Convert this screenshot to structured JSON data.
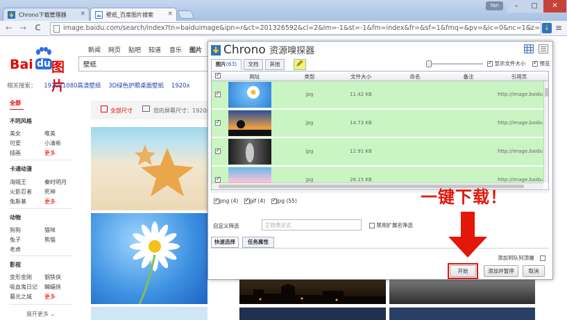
{
  "browser": {
    "tabs": [
      {
        "title": "Chrono下载管理器",
        "close": "×"
      },
      {
        "title": "壁纸_百度图片搜索",
        "close": "×"
      }
    ],
    "user_badge": "Yan",
    "window_buttons": {
      "minimize": "–",
      "maximize": "□",
      "close": "✕"
    },
    "nav": {
      "back": "←",
      "forward": "→",
      "reload": "C"
    },
    "address": "image.baidu.com/search/index?tn=baiduimage&ipn=r&ct=201326592&cl=2&lm=-1&st=-1&fm=index&fr=&sf=1&fmq=&pv=&ic=0&nc=1&z=",
    "star": "☆",
    "menu": "≡",
    "extension_icon": "↓"
  },
  "baidu": {
    "logo_left": "Bai",
    "logo_du": "du",
    "logo_right": "图片",
    "top_tabs": [
      "新闻",
      "网页",
      "贴吧",
      "知道",
      "音乐",
      "图片"
    ],
    "search_value": "壁纸",
    "related_label": "相关搜索：",
    "related_links": [
      "1920x1080高清壁纸",
      "3D绿色护眼桌面壁纸",
      "1920x"
    ],
    "sidebar": {
      "all": "全部",
      "groups": [
        {
          "title": "不同风格",
          "items": [
            "美女",
            "唯美",
            "可爱",
            "小清新",
            "插画",
            "更多"
          ]
        },
        {
          "title": "卡通动漫",
          "items": [
            "海贼王",
            "秦时明月",
            "火影忍者",
            "死神",
            "兔斯基",
            "更多"
          ]
        },
        {
          "title": "动物",
          "items": [
            "狗狗",
            "猫咪",
            "兔子",
            "熊猫",
            "老虎"
          ]
        },
        {
          "title": "影视",
          "items": [
            "变形金刚",
            "钢铁侠",
            "吸血鬼日记",
            "蝙蝠侠",
            "暮光之城",
            "更多"
          ]
        }
      ],
      "expand": "展开更多 ⌄"
    },
    "filter": {
      "all_sizes": "全部尺寸",
      "screen_size": "您的屏幕尺寸：1920x"
    }
  },
  "chrono": {
    "title": "Chrono",
    "subtitle": "资源嗅探器",
    "tabs": [
      {
        "label": "图片",
        "count": "(63)"
      },
      {
        "label": "文档"
      },
      {
        "label": "其他"
      }
    ],
    "show_size_label": "显示文件大小",
    "preview_label": "预览",
    "columns": [
      "网址",
      "类型",
      "文件大小",
      "命名",
      "备注",
      "引用页"
    ],
    "rows": [
      {
        "type": "jpg",
        "size": "11.42 KB",
        "ref": "http://image.baidu"
      },
      {
        "type": "jpg",
        "size": "14.73 KB",
        "ref": "http://image.baidu"
      },
      {
        "type": "jpg",
        "size": "12.91 KB",
        "ref": "http://image.baidu"
      },
      {
        "type": "jpg",
        "size": "26.15 KB",
        "ref": "http://image.baidu"
      }
    ],
    "file_types": [
      "png (4)",
      "gif (4)",
      "jpg (55)"
    ],
    "custom_filter_label": "自定义筛选",
    "custom_filter_placeholder": "正则表达式",
    "disable_ext_label": "禁用扩展名筛选",
    "bottom_tabs": [
      "快速选择",
      "任务属性"
    ],
    "queue_label": "添加到队列顶端",
    "buttons": {
      "start": "开始",
      "add_pause": "添加并暂停",
      "cancel": "取消"
    }
  },
  "annotation": {
    "text": "一键下载！",
    "color": "#e3170a"
  }
}
